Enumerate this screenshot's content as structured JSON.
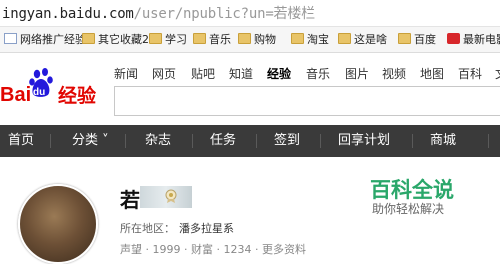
{
  "address": {
    "host": "ingyan.baidu.com",
    "path": "/user/npublic?un=若楼栏"
  },
  "bookmarks": [
    {
      "label": "网络推广经验",
      "icon": "page-icon"
    },
    {
      "label": "其它收藏2",
      "icon": "folder-icon"
    },
    {
      "label": "学习",
      "icon": "folder-icon"
    },
    {
      "label": "音乐",
      "icon": "folder-icon"
    },
    {
      "label": "购物",
      "icon": "folder-icon"
    },
    {
      "label": "淘宝",
      "icon": "folder-icon"
    },
    {
      "label": "这是啥",
      "icon": "folder-icon"
    },
    {
      "label": "百度",
      "icon": "folder-icon"
    },
    {
      "label": "最新电影",
      "icon": "red-icon"
    }
  ],
  "header": {
    "logo_text": "Baidu经验",
    "nav": [
      "新闻",
      "网页",
      "贴吧",
      "知道",
      "经验",
      "音乐",
      "图片",
      "视频",
      "地图",
      "百科",
      "文"
    ],
    "active_nav": "经验"
  },
  "menu": {
    "items": [
      "首页",
      "分类 ˅",
      "杂志",
      "任务",
      "签到",
      "回享计划",
      "商城"
    ]
  },
  "profile": {
    "name": "若",
    "location_label": "所在地区：",
    "location_value": "潘多拉星系",
    "stats_text": "声望 · 1999 · 财富 · 1234 · 更多资料"
  },
  "ad": {
    "title": "百科全说",
    "subtitle": "助你轻松解决"
  },
  "colors": {
    "menubar": "#3a3a3a",
    "baidu_red": "#e10601",
    "baidu_blue": "#2319dc",
    "ad_green": "#2aa76a"
  }
}
